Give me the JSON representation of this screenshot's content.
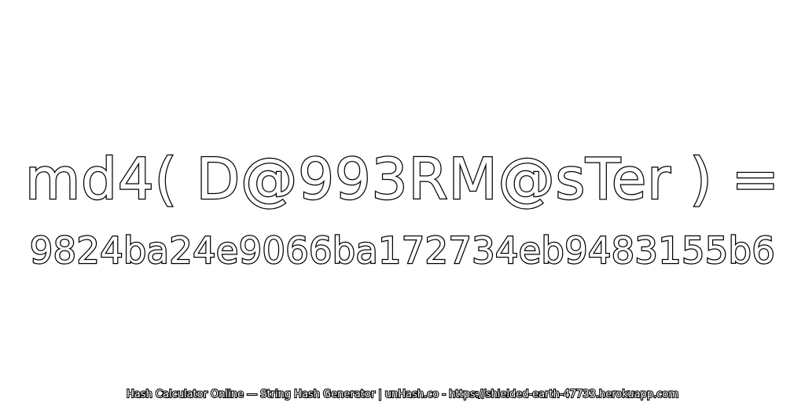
{
  "expression": "md4( D@993RM@sTer ) =",
  "hash": "9824ba24e9066ba172734eb9483155b6",
  "footer": "Hash Calculator Online — String Hash Generator | unHash.co - https://shielded-earth-47733.herokuapp.com",
  "colors": {
    "background": "#ffffff",
    "text_fill": "#ffffff",
    "text_stroke": "#000000"
  }
}
